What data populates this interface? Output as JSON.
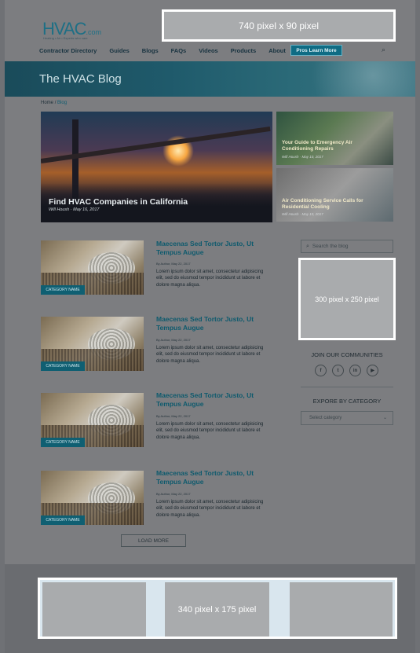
{
  "header": {
    "logo_main": "HVAC",
    "logo_suffix": ".com",
    "logo_tagline": "Heating • Air • Experts who care",
    "ad_top": "740 pixel x 90 pixel"
  },
  "nav": {
    "items": [
      "Contractor Directory",
      "Guides",
      "Blogs",
      "FAQs",
      "Videos",
      "Products",
      "About"
    ],
    "cta": "Pros Learn More",
    "search_icon": "search-icon"
  },
  "hero": {
    "title": "The HVAC Blog"
  },
  "breadcrumb": {
    "home": "Home",
    "sep": "/",
    "current": "Blog"
  },
  "featured": {
    "main": {
      "title": "Find HVAC Companies in California",
      "meta": "Will Housh · May 16, 2017"
    },
    "side": [
      {
        "title": "Your Guide to Emergency Air Conditioning Repairs",
        "meta": "Will Housh · May 10, 2017"
      },
      {
        "title": "Air Conditioning Service Calls for Residential Cooling",
        "meta": "Will Housh · May 10, 2017"
      }
    ]
  },
  "posts": [
    {
      "category": "CATEGORY NAME",
      "title": "Maecenas Sed Tortor Justo, Ut Tempus Augue",
      "meta": "By Author, May 22, 2017",
      "excerpt": "Lorem ipsum dolor sit amet, consectetur adipisicing elit, sed do eiusmod tempor incididunt ut labore et dolore magna aliqua."
    },
    {
      "category": "CATEGORY NAME",
      "title": "Maecenas Sed Tortor Justo, Ut Tempus Augue",
      "meta": "By Author, May 22, 2017",
      "excerpt": "Lorem ipsum dolor sit amet, consectetur adipisicing elit, sed do eiusmod tempor incididunt ut labore et dolore magna aliqua."
    },
    {
      "category": "CATEGORY NAME",
      "title": "Maecenas Sed Tortor Justo, Ut Tempus Augue",
      "meta": "By Author, May 22, 2017",
      "excerpt": "Lorem ipsum dolor sit amet, consectetur adipisicing elit, sed do eiusmod tempor incididunt ut labore et dolore magna aliqua."
    },
    {
      "category": "CATEGORY NAME",
      "title": "Maecenas Sed Tortor Justo, Ut Tempus Augue",
      "meta": "By Author, May 22, 2017",
      "excerpt": "Lorem ipsum dolor sit amet, consectetur adipisicing elit, sed do eiusmod tempor incididunt ut labore et dolore magna aliqua."
    }
  ],
  "load_more": "LOAD MORE",
  "sidebar": {
    "search_placeholder": "Search the blog",
    "ad_side": "300 pixel x 250 pixel",
    "communities_heading": "JOIN OUR COMMUNITIES",
    "socials": [
      {
        "icon": "facebook-icon",
        "glyph": "f"
      },
      {
        "icon": "twitter-icon",
        "glyph": "t"
      },
      {
        "icon": "linkedin-icon",
        "glyph": "in"
      },
      {
        "icon": "youtube-icon",
        "glyph": "▶"
      }
    ],
    "category_heading": "EXPORE BY CATEGORY",
    "category_select": "Select category"
  },
  "footer_ad": {
    "label": "340 pixel x 175 pixel"
  },
  "colors": {
    "brand": "#1e6f85",
    "accent": "#0f5f72",
    "ad": "#a9abad"
  }
}
